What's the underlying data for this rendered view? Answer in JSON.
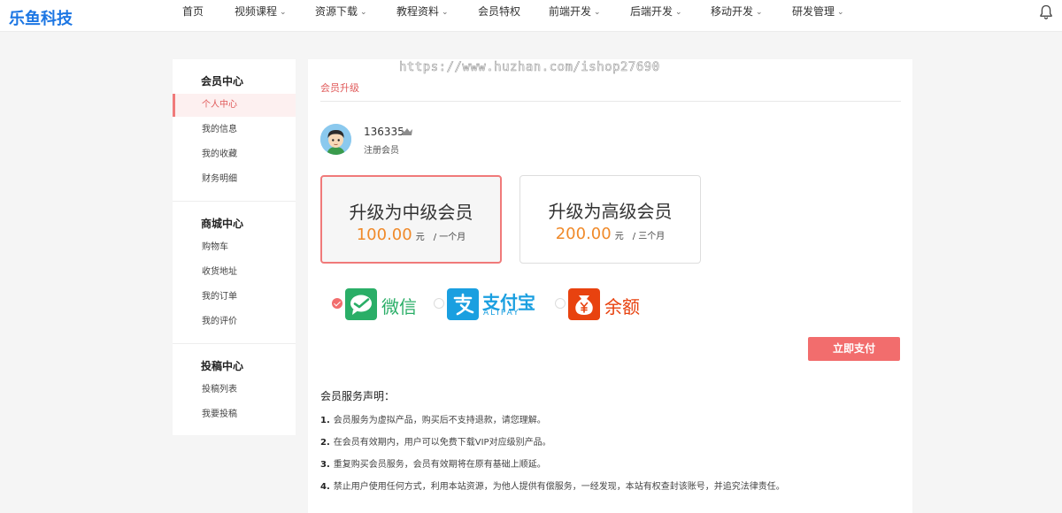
{
  "brand": {
    "logo_text": "乐鱼科技"
  },
  "nav": {
    "items": [
      {
        "label": "首页",
        "has_dropdown": false
      },
      {
        "label": "视频课程",
        "has_dropdown": true
      },
      {
        "label": "资源下载",
        "has_dropdown": true
      },
      {
        "label": "教程资料",
        "has_dropdown": true
      },
      {
        "label": "会员特权",
        "has_dropdown": false
      },
      {
        "label": "前端开发",
        "has_dropdown": true
      },
      {
        "label": "后端开发",
        "has_dropdown": true
      },
      {
        "label": "移动开发",
        "has_dropdown": true
      },
      {
        "label": "研发管理",
        "has_dropdown": true
      }
    ],
    "chevron_glyph": "⌄",
    "notification_icon": "bell-icon"
  },
  "sidebar": {
    "groups": [
      {
        "title": "会员中心",
        "items": [
          "个人中心",
          "我的信息",
          "我的收藏",
          "财务明细"
        ]
      },
      {
        "title": "商城中心",
        "items": [
          "购物车",
          "收货地址",
          "我的订单",
          "我的评价"
        ]
      },
      {
        "title": "投稿中心",
        "items": [
          "投稿列表",
          "我要投稿"
        ]
      }
    ],
    "active_item": "个人中心"
  },
  "main": {
    "watermark": "https://www.huzhan.com/ishop27690",
    "page_title": "会员升级",
    "user": {
      "name": "136335",
      "member_type": "注册会员",
      "badge_icon": "crown-icon"
    },
    "plans": [
      {
        "name": "升级为中级会员",
        "price": "100.00",
        "unit": "元",
        "period": "/ 一个月",
        "selected": true
      },
      {
        "name": "升级为高级会员",
        "price": "200.00",
        "unit": "元",
        "period": "/ 三个月",
        "selected": false
      }
    ],
    "payment_methods": [
      {
        "label": "微信",
        "sub": "",
        "icon": "wechat-pay-icon",
        "color": "#2aae67",
        "checked": true
      },
      {
        "label": "支付宝",
        "sub": "ALIPAY",
        "icon": "alipay-icon",
        "color": "#1a9fe0",
        "checked": false
      },
      {
        "label": "余额",
        "sub": "",
        "icon": "balance-icon",
        "color": "#e8420f",
        "checked": false
      }
    ],
    "pay_button": "立即支付",
    "notice": {
      "title": "会员服务声明：",
      "items": [
        {
          "num": "1.",
          "text": "会员服务为虚拟产品，购买后不支持退款，请您理解。"
        },
        {
          "num": "2.",
          "text": "在会员有效期内，用户可以免费下载VIP对应级别产品。"
        },
        {
          "num": "3.",
          "text": "重复购买会员服务，会员有效期将在原有基础上顺延。"
        },
        {
          "num": "4.",
          "text": "禁止用户使用任何方式，利用本站资源，为他人提供有偿服务，一经发现，本站有权查封该账号，并追究法律责任。"
        }
      ]
    }
  },
  "colors": {
    "accent": "#f26d6d",
    "price": "#f08a2a",
    "logo": "#1c76e3"
  }
}
